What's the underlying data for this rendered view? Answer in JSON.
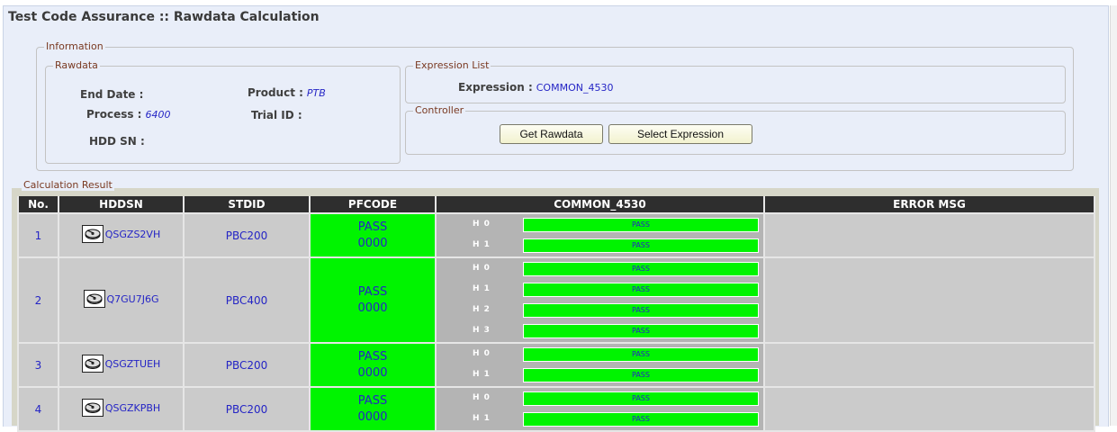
{
  "title": "Test Code Assurance :: Rawdata Calculation",
  "information": {
    "legend": "Information",
    "rawdata": {
      "legend": "Rawdata",
      "end_date_label": "End Date :",
      "end_date_value": "",
      "product_label": "Product :",
      "product_value": "PTB",
      "process_label": "Process :",
      "process_value": "6400",
      "trial_id_label": "Trial ID :",
      "trial_id_value": "",
      "hdd_sn_label": "HDD SN :",
      "hdd_sn_value": ""
    },
    "expression_list": {
      "legend": "Expression List",
      "expression_label": "Expression :",
      "expression_value": "COMMON_4530"
    },
    "controller": {
      "legend": "Controller",
      "get_rawdata_label": "Get Rawdata",
      "select_expression_label": "Select Expression"
    }
  },
  "results": {
    "legend": "Calculation Result",
    "columns": [
      "No.",
      "HDDSN",
      "STDID",
      "PFCODE",
      "COMMON_4530",
      "ERROR MSG"
    ],
    "rows": [
      {
        "no": "1",
        "hddsn": "QSGZS2VH",
        "stdid": "PBC200",
        "pf_status": "PASS",
        "pf_code": "0000",
        "heads": [
          {
            "label": "H 0",
            "result": "PASS"
          },
          {
            "label": "H 1",
            "result": "PASS"
          }
        ],
        "error": ""
      },
      {
        "no": "2",
        "hddsn": "Q7GU7J6G",
        "stdid": "PBC400",
        "pf_status": "PASS",
        "pf_code": "0000",
        "heads": [
          {
            "label": "H 0",
            "result": "PASS"
          },
          {
            "label": "H 1",
            "result": "PASS"
          },
          {
            "label": "H 2",
            "result": "PASS"
          },
          {
            "label": "H 3",
            "result": "PASS"
          }
        ],
        "error": ""
      },
      {
        "no": "3",
        "hddsn": "QSGZTUEH",
        "stdid": "PBC200",
        "pf_status": "PASS",
        "pf_code": "0000",
        "heads": [
          {
            "label": "H 0",
            "result": "PASS"
          },
          {
            "label": "H 1",
            "result": "PASS"
          }
        ],
        "error": ""
      },
      {
        "no": "4",
        "hddsn": "QSGZKPBH",
        "stdid": "PBC200",
        "pf_status": "PASS",
        "pf_code": "0000",
        "heads": [
          {
            "label": "H 0",
            "result": "PASS"
          },
          {
            "label": "H 1",
            "result": "PASS"
          }
        ],
        "error": ""
      }
    ]
  },
  "icons": {
    "hdd": "hard-drive-icon"
  },
  "colors": {
    "pass_green": "#00f400",
    "header_dark": "#2e2e2e",
    "link_blue": "#2525c5",
    "legend_brown": "#7a3a22"
  }
}
